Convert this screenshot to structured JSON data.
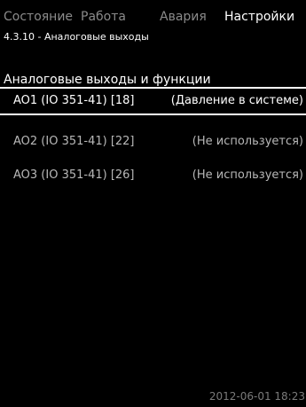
{
  "tabs": [
    {
      "label": "Состояние",
      "active": false
    },
    {
      "label": "Работа",
      "active": false
    },
    {
      "label": "Авария",
      "active": false
    },
    {
      "label": "Настройки",
      "active": true
    }
  ],
  "path": "4.3.10 - Аналоговые выходы",
  "section_header": "Аналоговые выходы и функции",
  "outputs": [
    {
      "name": "AO1 (IO 351-41) [18]",
      "value": "(Давление в системе)",
      "selected": true
    },
    {
      "name": "AO2 (IO 351-41) [22]",
      "value": "(Не используется)",
      "selected": false
    },
    {
      "name": "AO3 (IO 351-41) [26]",
      "value": "(Не используется)",
      "selected": false
    }
  ],
  "datetime": "2012-06-01 18:23",
  "colors": {
    "background": "#000000",
    "text": "#ffffff",
    "inactive_tab": "#8a8a8a",
    "timestamp": "#7a7a7a"
  }
}
